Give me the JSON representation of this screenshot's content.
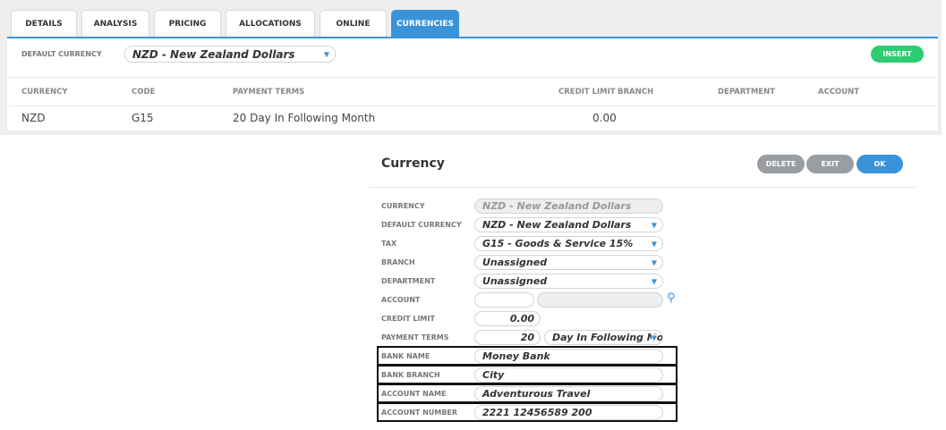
{
  "tabs": [
    "DETAILS",
    "ANALYSIS",
    "PRICING",
    "ALLOCATIONS",
    "ONLINE",
    "CURRENCIES"
  ],
  "active_tab": "CURRENCIES",
  "default_currency": {
    "label": "DEFAULT CURRENCY",
    "value": "NZD - New Zealand Dollars"
  },
  "insert_label": "INSERT",
  "table": {
    "headers": [
      "CURRENCY",
      "CODE",
      "PAYMENT TERMS",
      "CREDIT LIMIT",
      "BRANCH",
      "DEPARTMENT",
      "ACCOUNT"
    ],
    "rows": [
      [
        "NZD",
        "G15",
        "20 Day In Following Month",
        "0.00",
        "",
        "",
        ""
      ]
    ]
  },
  "dialog": {
    "title": "Currency",
    "delete": "DELETE",
    "exit": "EXIT",
    "ok": "OK",
    "fields": {
      "currency": {
        "label": "CURRENCY",
        "value": "NZD - New Zealand Dollars"
      },
      "default_currency": {
        "label": "DEFAULT CURRENCY",
        "value": "NZD - New Zealand Dollars"
      },
      "tax": {
        "label": "TAX",
        "value": "G15 - Goods & Service 15%"
      },
      "branch": {
        "label": "BRANCH",
        "value": "Unassigned"
      },
      "department": {
        "label": "DEPARTMENT",
        "value": "Unassigned"
      },
      "account": {
        "label": "ACCOUNT",
        "code": "",
        "name": ""
      },
      "credit_limit": {
        "label": "CREDIT LIMIT",
        "value": "0.00"
      },
      "payment_terms": {
        "label": "PAYMENT TERMS",
        "days": "20",
        "type": "Day In Following Mont"
      },
      "bank_name": {
        "label": "BANK NAME",
        "value": "Money Bank"
      },
      "bank_branch": {
        "label": "BANK BRANCH",
        "value": "City"
      },
      "account_name": {
        "label": "ACCOUNT NAME",
        "value": "Adventurous Travel"
      },
      "account_number": {
        "label": "ACCOUNT NUMBER",
        "value": "2221 12456589 200"
      }
    }
  },
  "colors": {
    "accent": "#3a93d8",
    "insert": "#2ecc71",
    "secondary": "#9a9ea2"
  }
}
